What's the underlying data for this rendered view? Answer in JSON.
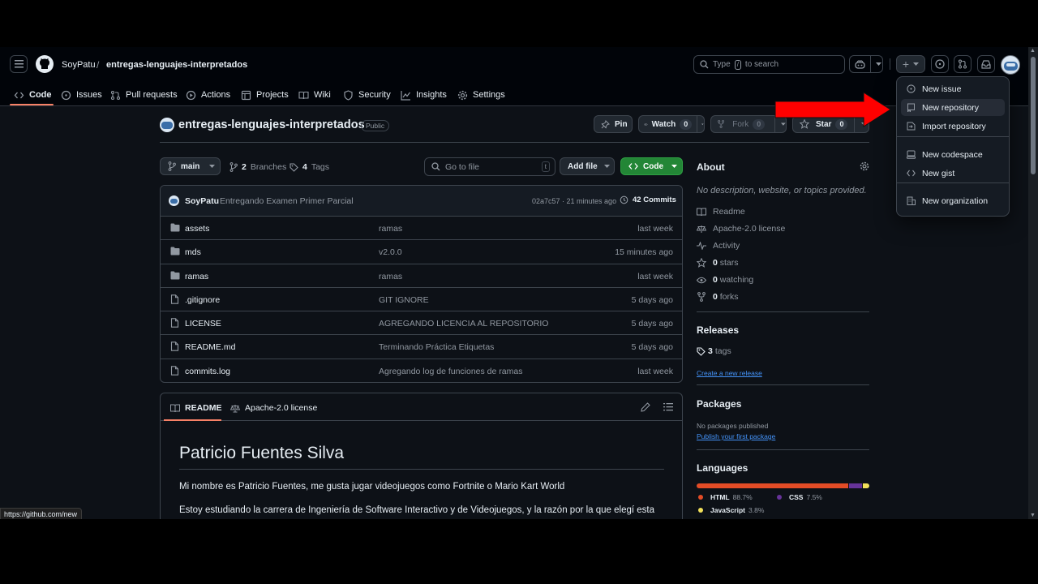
{
  "colors": {
    "accent_orange": "#f78166",
    "green_btn": "#238636",
    "link": "#4493f8",
    "arrow": "#ff0000",
    "html": "#e34c26",
    "css": "#663399",
    "js": "#f1e05a"
  },
  "nav": {
    "owner": "SoyPatu",
    "separator": "/",
    "repo": "entregas-lenguajes-interpretados",
    "search_prefix": "Type",
    "search_key": "/",
    "search_suffix": "to search",
    "plus_label": "+"
  },
  "tabs": [
    {
      "label": "Code",
      "icon": "code-icon"
    },
    {
      "label": "Issues",
      "icon": "issue-icon"
    },
    {
      "label": "Pull requests",
      "icon": "pull-request-icon"
    },
    {
      "label": "Actions",
      "icon": "play-icon"
    },
    {
      "label": "Projects",
      "icon": "table-icon"
    },
    {
      "label": "Wiki",
      "icon": "book-icon"
    },
    {
      "label": "Security",
      "icon": "shield-icon"
    },
    {
      "label": "Insights",
      "icon": "graph-icon"
    },
    {
      "label": "Settings",
      "icon": "gear-icon"
    }
  ],
  "repo_header": {
    "name": "entregas-lenguajes-interpretados",
    "visibility": "Public",
    "pin": "Pin",
    "watch": "Watch",
    "watch_count": "0",
    "fork": "Fork",
    "fork_count": "0",
    "star": "Star",
    "star_count": "0"
  },
  "toolbar": {
    "branch": "main",
    "branches_count": "2",
    "branches_label": "Branches",
    "tags_count": "4",
    "tags_label": "Tags",
    "goto_placeholder": "Go to file",
    "goto_key": "t",
    "add_file": "Add file",
    "code": "Code"
  },
  "commit": {
    "author": "SoyPatu",
    "message": "Entregando Examen Primer Parcial",
    "hash_time": "02a7c57 · 21 minutes ago",
    "count": "42 Commits"
  },
  "files": [
    {
      "type": "folder",
      "name": "assets",
      "message": "ramas",
      "time": "last week"
    },
    {
      "type": "folder",
      "name": "mds",
      "message": "v2.0.0",
      "time": "15 minutes ago"
    },
    {
      "type": "folder",
      "name": "ramas",
      "message": "ramas",
      "time": "last week"
    },
    {
      "type": "file",
      "name": ".gitignore",
      "message": "GIT IGNORE",
      "time": "5 days ago"
    },
    {
      "type": "file",
      "name": "LICENSE",
      "message": "AGREGANDO LICENCIA AL REPOSITORIO",
      "time": "5 days ago"
    },
    {
      "type": "file",
      "name": "README.md",
      "message": "Terminando Práctica Etiquetas",
      "time": "5 days ago"
    },
    {
      "type": "file",
      "name": "commits.log",
      "message": "Agregando log de funciones de ramas",
      "time": "last week"
    }
  ],
  "readme": {
    "tab_readme": "README",
    "tab_license": "Apache-2.0 license",
    "heading": "Patricio Fuentes Silva",
    "p1": "Mi nombre es Patricio Fuentes, me gusta jugar videojuegos como Fortnite o Mario Kart World",
    "p2": "Estoy estudiando la carrera de Ingeniería de Software Interactivo y de Videojuegos, y la razón por la que elegí esta"
  },
  "about": {
    "title": "About",
    "description": "No description, website, or topics provided.",
    "readme": "Readme",
    "license": "Apache-2.0 license",
    "activity": "Activity",
    "stars_count": "0",
    "stars": "stars",
    "watching_count": "0",
    "watching": "watching",
    "forks_count": "0",
    "forks": "forks"
  },
  "releases": {
    "title": "Releases",
    "tags_count": "3",
    "tags": "tags",
    "create": "Create a new release"
  },
  "packages": {
    "title": "Packages",
    "none": "No packages published",
    "publish": "Publish your first package"
  },
  "languages": {
    "title": "Languages",
    "items": [
      {
        "name": "HTML",
        "pct": "88.7%",
        "value": 88.7
      },
      {
        "name": "CSS",
        "pct": "7.5%",
        "value": 7.5
      },
      {
        "name": "JavaScript",
        "pct": "3.8%",
        "value": 3.8
      }
    ]
  },
  "dropdown": {
    "items": [
      {
        "label": "New issue",
        "icon": "issue-icon"
      },
      {
        "label": "New repository",
        "icon": "repo-icon"
      },
      {
        "label": "Import repository",
        "icon": "import-icon"
      },
      {
        "label": "New codespace",
        "icon": "codespace-icon"
      },
      {
        "label": "New gist",
        "icon": "code-icon"
      },
      {
        "label": "New organization",
        "icon": "organization-icon"
      }
    ]
  },
  "status_url": "https://github.com/new"
}
